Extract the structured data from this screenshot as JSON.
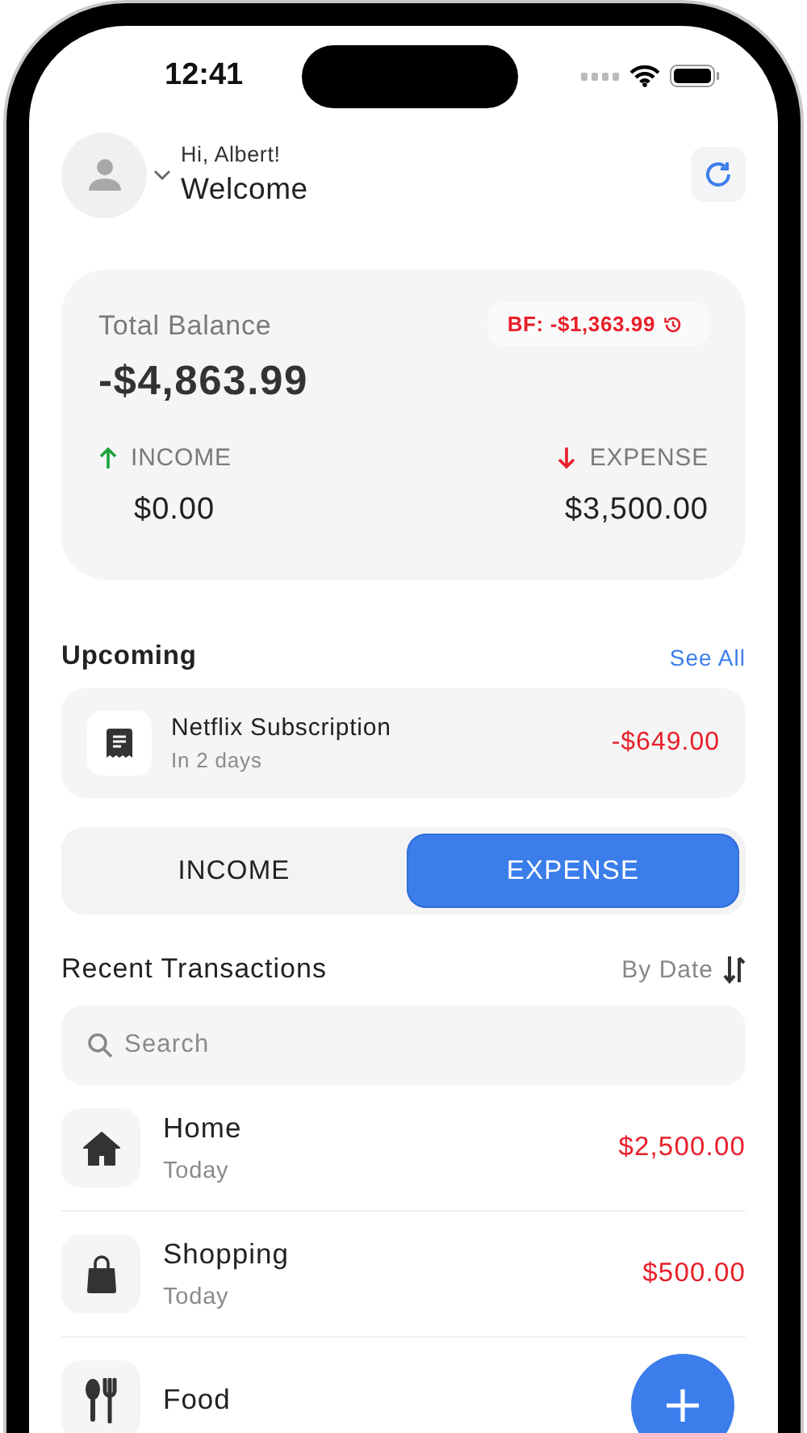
{
  "status_bar": {
    "time": "12:41"
  },
  "header": {
    "greeting": "Hi, Albert!",
    "title": "Welcome"
  },
  "balance": {
    "label": "Total Balance",
    "amount": "-$4,863.99",
    "brought_forward": "BF: -$1,363.99",
    "income": {
      "label": "INCOME",
      "amount": "$0.00"
    },
    "expense": {
      "label": "EXPENSE",
      "amount": "$3,500.00"
    }
  },
  "upcoming": {
    "title": "Upcoming",
    "link": "See All",
    "items": [
      {
        "name": "Netflix Subscription",
        "due": "In 2 days",
        "amount": "-$649.00"
      }
    ]
  },
  "type_toggle": [
    {
      "label": "INCOME",
      "selected": false
    },
    {
      "label": "EXPENSE",
      "selected": true
    }
  ],
  "transactions": {
    "title": "Recent Transactions",
    "sort": "By Date",
    "search": {
      "placeholder": "Search"
    },
    "items": [
      {
        "kind": "home",
        "name": "Home",
        "date": "Today",
        "amount": "$2,500.00"
      },
      {
        "kind": "shopping",
        "name": "Shopping",
        "date": "Today",
        "amount": "$500.00"
      },
      {
        "kind": "food",
        "name": "Food"
      }
    ]
  }
}
